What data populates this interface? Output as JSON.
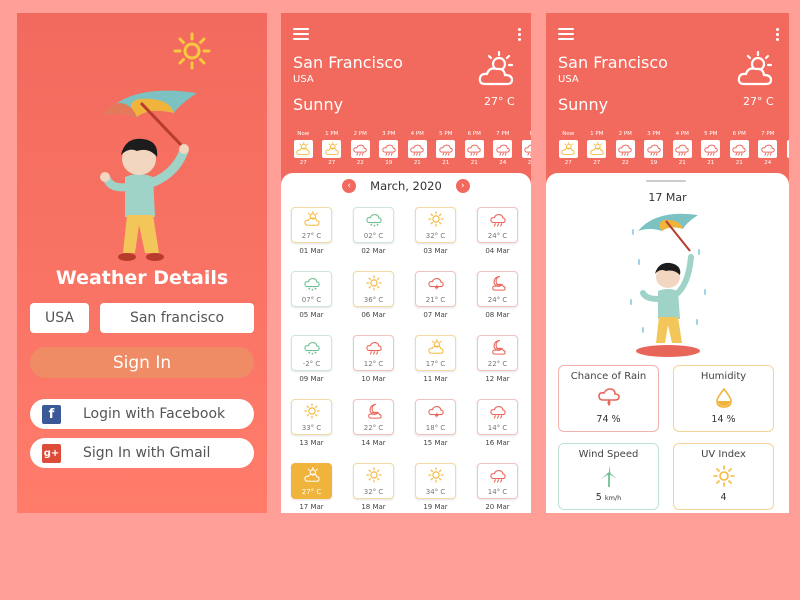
{
  "screen1": {
    "title": "Weather Details",
    "country": "USA",
    "city": "San francisco",
    "signin": "Sign In",
    "facebook": "Login with Facebook",
    "gmail": "Sign In with Gmail"
  },
  "header": {
    "city": "San Francisco",
    "country": "USA",
    "condition": "Sunny",
    "temp": "27° C"
  },
  "hours": [
    "Now",
    "1 PM",
    "2 PM",
    "3 PM",
    "4 PM",
    "5 PM",
    "6 PM",
    "7 PM",
    "8"
  ],
  "hour_temps": [
    "27",
    "27",
    "22",
    "19",
    "21",
    "21",
    "21",
    "24",
    "27"
  ],
  "hour_icons": [
    "partly-cloudy-icon",
    "partly-cloudy-icon",
    "rain-icon",
    "rain-icon",
    "rain-icon",
    "rain-icon",
    "rain-icon",
    "rain-icon",
    "rain-icon"
  ],
  "calendar": {
    "month": "March, 2020",
    "prev": "‹",
    "next": "›",
    "days": [
      {
        "temp": "27° C",
        "date": "01 Mar",
        "icon": "partly-cloudy-icon",
        "kind": "warm"
      },
      {
        "temp": "02° C",
        "date": "02 Mar",
        "icon": "snow-cloud-icon",
        "kind": "cold"
      },
      {
        "temp": "32° C",
        "date": "03 Mar",
        "icon": "sun-icon",
        "kind": "warm"
      },
      {
        "temp": "24° C",
        "date": "04 Mar",
        "icon": "rain-icon",
        "kind": "rain"
      },
      {
        "temp": "07° C",
        "date": "05 Mar",
        "icon": "snow-cloud-icon",
        "kind": "cold"
      },
      {
        "temp": "36° C",
        "date": "06 Mar",
        "icon": "sun-icon",
        "kind": "warm"
      },
      {
        "temp": "21° C",
        "date": "07 Mar",
        "icon": "storm-icon",
        "kind": "rain"
      },
      {
        "temp": "24° C",
        "date": "08 Mar",
        "icon": "night-icon",
        "kind": "rain"
      },
      {
        "temp": "-2° C",
        "date": "09 Mar",
        "icon": "snow-cloud-icon",
        "kind": "cold"
      },
      {
        "temp": "12° C",
        "date": "10 Mar",
        "icon": "rain-icon",
        "kind": "rain"
      },
      {
        "temp": "17° C",
        "date": "11 Mar",
        "icon": "partly-cloudy-icon",
        "kind": "warm"
      },
      {
        "temp": "22° C",
        "date": "12 Mar",
        "icon": "night-icon",
        "kind": "rain"
      },
      {
        "temp": "33° C",
        "date": "13 Mar",
        "icon": "sun-icon",
        "kind": "warm"
      },
      {
        "temp": "22° C",
        "date": "14 Mar",
        "icon": "night-icon",
        "kind": "rain"
      },
      {
        "temp": "18° C",
        "date": "15 Mar",
        "icon": "storm-icon",
        "kind": "rain"
      },
      {
        "temp": "14° C",
        "date": "16 Mar",
        "icon": "rain-icon",
        "kind": "rain"
      },
      {
        "temp": "27° C",
        "date": "17 Mar",
        "icon": "partly-cloudy-icon",
        "kind": "sel"
      },
      {
        "temp": "32° C",
        "date": "18 Mar",
        "icon": "sun-icon",
        "kind": "warm"
      },
      {
        "temp": "34° C",
        "date": "19 Mar",
        "icon": "sun-icon",
        "kind": "warm"
      },
      {
        "temp": "14° C",
        "date": "20 Mar",
        "icon": "rain-icon",
        "kind": "rain"
      }
    ]
  },
  "detail": {
    "date": "17 Mar",
    "rain_label": "Chance of Rain",
    "rain_value": "74 %",
    "humidity_label": "Humidity",
    "humidity_value": "14 %",
    "wind_label": "Wind Speed",
    "wind_value": "5",
    "wind_unit": "km/h",
    "uv_label": "UV Index",
    "uv_value": "4"
  },
  "colors": {
    "primary": "#f26a5d",
    "background": "#ff9f97",
    "signin_button": "#f08c65",
    "selected_day": "#f0b43c",
    "rain": "#e8655a",
    "sun": "#f5b93b",
    "cold": "#6fbf8f"
  }
}
